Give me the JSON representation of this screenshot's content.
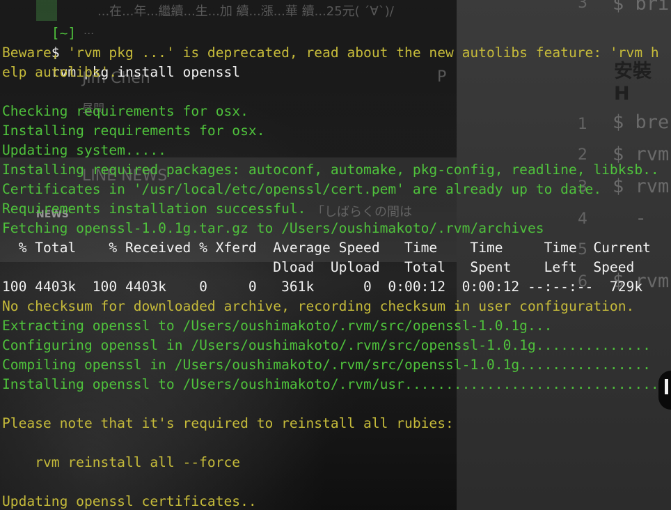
{
  "prompt": {
    "path": "[~]",
    "symbol": "$",
    "command": "rvm pkg install openssl"
  },
  "output": {
    "beware_1": "Beware, 'rvm pkg ...' is deprecated, read about the new autolibs feature: 'rvm h",
    "beware_2": "elp autolibs'.",
    "checking": "Checking requirements for osx.",
    "installing_req": "Installing requirements for osx.",
    "updating_system": "Updating system.....",
    "installing_packages": "Installing required packages: autoconf, automake, pkg-config, readline, libksb..",
    "certificates": "Certificates in '/usr/local/etc/openssl/cert.pem' are already up to date.",
    "requirements_success": "Requirements installation successful.",
    "fetching": "Fetching openssl-1.0.1g.tar.gz to /Users/oushimakoto/.rvm/archives",
    "curl_header_1": "  % Total    % Received % Xferd  Average Speed   Time    Time     Time  Current",
    "curl_header_2": "                                 Dload  Upload   Total   Spent    Left  Speed",
    "curl_progress": "100 4403k  100 4403k    0     0   361k      0  0:00:12  0:00:12 --:--:--  729k",
    "no_checksum": "No checksum for downloaded archive, recording checksum in user configuration.",
    "extracting": "Extracting openssl to /Users/oushimakoto/.rvm/src/openssl-1.0.1g...",
    "configuring": "Configuring openssl in /Users/oushimakoto/.rvm/src/openssl-1.0.1g..............",
    "compiling": "Compiling openssl in /Users/oushimakoto/.rvm/src/openssl-1.0.1g................",
    "installing_openssl": "Installing openssl to /Users/oushimakoto/.rvm/usr...............................",
    "please_note": "Please note that it's required to reinstall all rubies:",
    "reinstall_cmd": "    rvm reinstall all --force",
    "updating_certs": "Updating openssl certificates.."
  },
  "background": {
    "top_cjk_text": "...在...年...繼續...生...加 續...漲...華 續...25元( ´∀`)/",
    "ellipsis": "...",
    "author": "Jim Chen",
    "kanji_line": "昼間",
    "line_news": "LINE NEWS",
    "news_badge": "NEWS",
    "japanese_line": "「しばらくの間は",
    "heading": "安裝 H",
    "code_lines": [
      "$ bre",
      "$ rvm",
      "$ rvm",
      "  -",
      "  -",
      "$ rvm"
    ],
    "line_numbers": [
      "3",
      "1",
      "2",
      "3",
      "4",
      "5",
      "6"
    ],
    "top_code": "$ bri",
    "p_letter": "P"
  },
  "colors": {
    "terminal_green": "#4fc23c",
    "terminal_yellow": "#c6bb3a",
    "terminal_white": "#f2f2f2",
    "background": "#0d0d0d"
  }
}
